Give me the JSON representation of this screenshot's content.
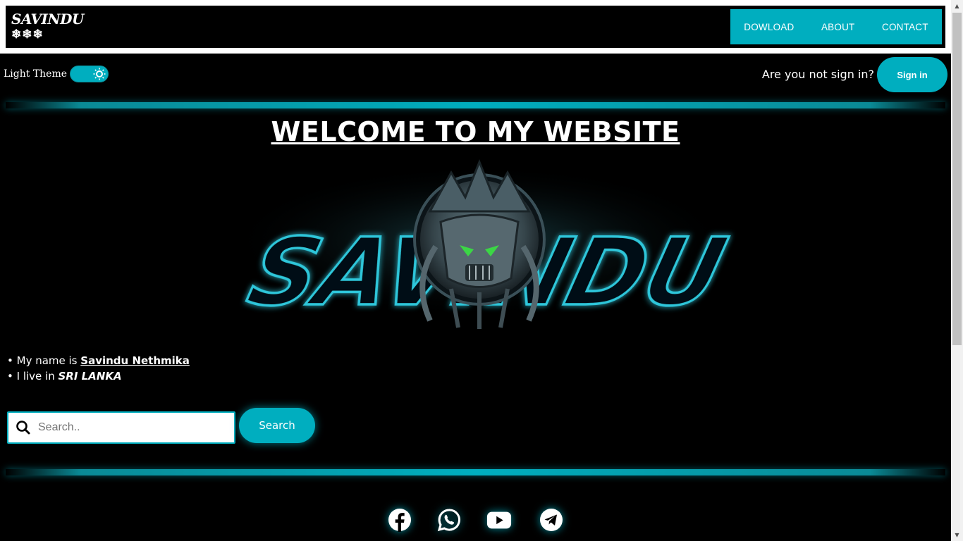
{
  "header": {
    "logo_text": "SAVINDU",
    "logo_flakes": "❄❄❄",
    "nav": [
      "DOWLOAD",
      "ABOUT",
      "CONTACT"
    ]
  },
  "theme": {
    "label": "Light Theme"
  },
  "signin": {
    "question": "Are you not sign in?",
    "button": "Sign in"
  },
  "main": {
    "welcome": "WELCOME TO MY WEBSITE",
    "hero_text": "SAVINDU",
    "info": {
      "name_prefix": "My name is ",
      "name": "Savindu Nethmika",
      "live_prefix": "I live in ",
      "country": "SRI LANKA"
    }
  },
  "search": {
    "placeholder": "Search..",
    "button": "Search"
  },
  "socials": [
    "facebook-icon",
    "whatsapp-icon",
    "youtube-icon",
    "telegram-icon"
  ],
  "colors": {
    "accent": "#00aebf",
    "background": "#000000"
  }
}
